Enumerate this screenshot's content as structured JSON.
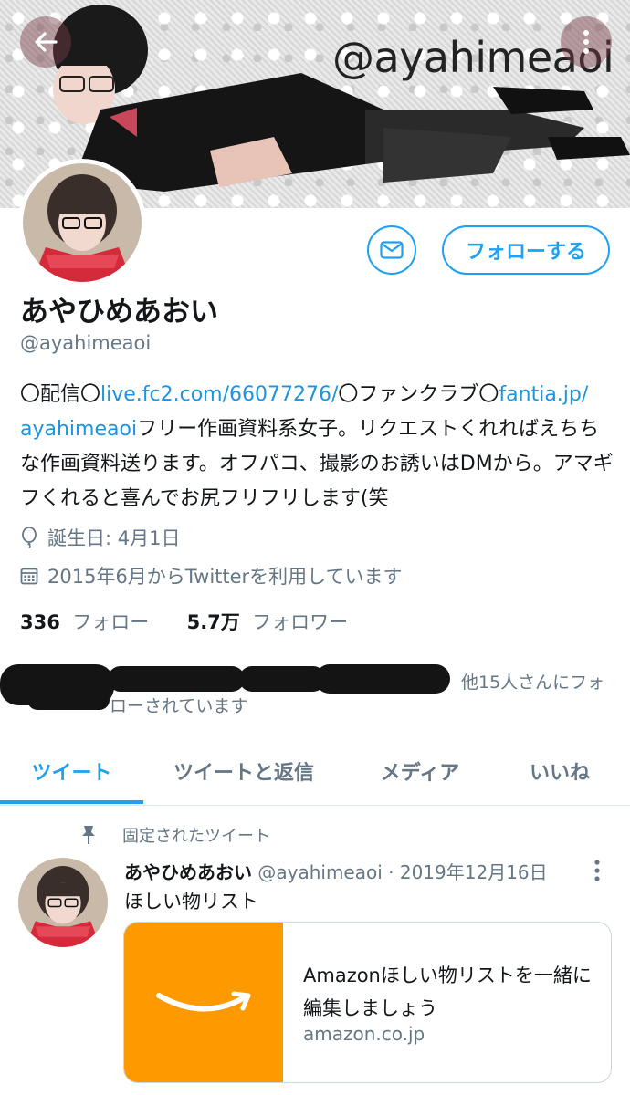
{
  "header": {
    "banner_handle": "@ayahimeaoi",
    "back_icon": "arrow-left-icon",
    "more_icon": "more-vertical-icon"
  },
  "profile": {
    "name": "あやひめあおい",
    "handle": "@ayahimeaoi",
    "follow_label": "フォローする",
    "message_icon": "mail-icon",
    "bio": {
      "p1": "〇配信〇",
      "link1": "live.fc2.com/66077276/",
      "p2": "〇ファンクラブ〇",
      "link2a": "fantia.jp/",
      "link2b": "ayahimeaoi",
      "p3": "フリー作画資料系女子。リクエストくれればえちちな作画資料送ります。オフパコ、撮影のお誘いはDMから。アマギフくれると喜んでお尻フリフリします(笑"
    },
    "birthday": "誕生日: 4月1日",
    "joined": "2015年6月からTwitterを利用しています",
    "following_count": "336",
    "following_label": "フォロー",
    "followers_count": "5.7万",
    "followers_label": "フォロワー",
    "followed_by_right": "他15人さんにフォ",
    "followed_by_bottom": "ローされています"
  },
  "tabs": [
    {
      "label": "ツイート",
      "active": true
    },
    {
      "label": "ツイートと返信",
      "active": false
    },
    {
      "label": "メディア",
      "active": false
    },
    {
      "label": "いいね",
      "active": false
    }
  ],
  "tweet": {
    "pinned_label": "固定されたツイート",
    "author": "あやひめあおい",
    "handle": "@ayahimeaoi",
    "dot": "·",
    "date": "2019年12月16日",
    "text": "ほしい物リスト",
    "card": {
      "title": "Amazonほしい物リストを一緒に編集しましょう",
      "url": "amazon.co.jp"
    }
  },
  "colors": {
    "accent": "#1da1f2",
    "link": "#1b95e0",
    "secondary_text": "#657786",
    "amazon_orange": "#ff9900"
  }
}
